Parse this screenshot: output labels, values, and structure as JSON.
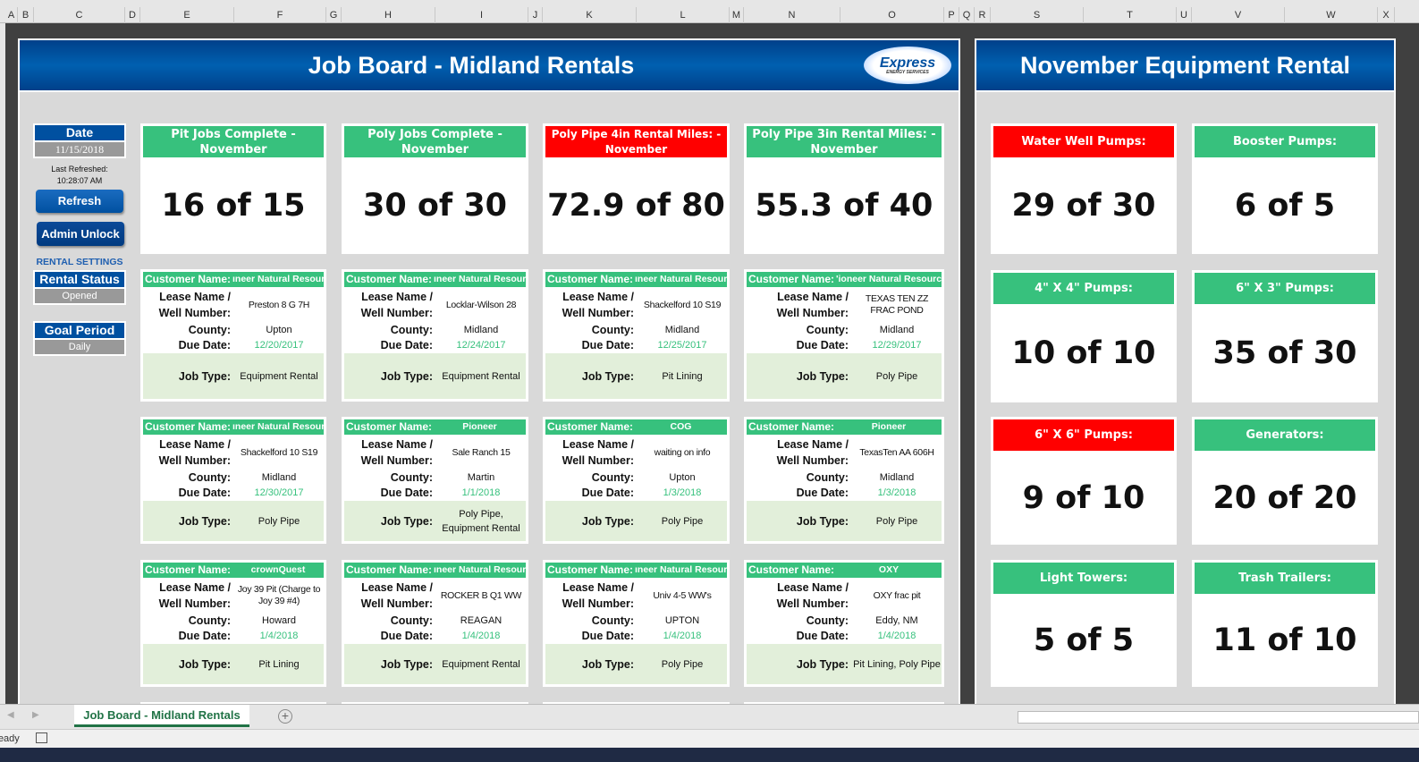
{
  "columns": [
    "A",
    "B",
    "C",
    "D",
    "E",
    "F",
    "G",
    "H",
    "I",
    "J",
    "K",
    "L",
    "M",
    "N",
    "O",
    "P",
    "Q",
    "R",
    "S",
    "T",
    "U",
    "V",
    "W",
    "X"
  ],
  "left_title": "Job Board - Midland Rentals",
  "logo": {
    "text": "Express",
    "sub": "ENERGY SERVICES"
  },
  "right_title": "November Equipment Rental",
  "colors": {
    "green": "#37c17d",
    "red": "#ff0000",
    "blue": "#0050a0",
    "light_green": "#e2efda"
  },
  "sidebar": {
    "date_label": "Date",
    "date_value": "11/15/2018",
    "last_refreshed": "Last Refreshed:",
    "refresh_time": "10:28:07 AM",
    "refresh_button": "Refresh",
    "admin_button": "Admin Unlock",
    "settings_label": "RENTAL SETTINGS",
    "rental_status_label": "Rental Status",
    "rental_status_value": "Opened",
    "goal_period_label": "Goal Period",
    "goal_period_value": "Daily"
  },
  "kpis": [
    {
      "title": "Pit Jobs Complete - November",
      "value": "16 of 15",
      "status": "green"
    },
    {
      "title": "Poly Jobs Complete - November",
      "value": "30 of 30",
      "status": "green"
    },
    {
      "title": "Poly Pipe 4in Rental Miles: - November",
      "value": "72.9 of 80",
      "status": "red"
    },
    {
      "title": "Poly Pipe 3in Rental Miles: - November",
      "value": "55.3 of 40",
      "status": "green"
    }
  ],
  "labels": {
    "customer": "Customer Name:",
    "lease": "Lease Name /",
    "well": "Well Number:",
    "county": "County:",
    "due": "Due Date:",
    "jobtype": "Job Type:"
  },
  "jobs": [
    {
      "customer": "ıneer Natural Resourc",
      "lease": "Preston 8 G 7H",
      "county": "Upton",
      "due": "12/20/2017",
      "type": "Equipment Rental"
    },
    {
      "customer": "ıneer Natural Resourc",
      "lease": "Locklar-Wilson 28",
      "county": "Midland",
      "due": "12/24/2017",
      "type": "Equipment Rental"
    },
    {
      "customer": "ıneer Natural Resourc",
      "lease": "Shackelford 10 S19",
      "county": "Midland",
      "due": "12/25/2017",
      "type": "Pit Lining"
    },
    {
      "customer": "'ioneer Natural Resource",
      "lease": "TEXAS TEN ZZ FRAC POND",
      "county": "Midland",
      "due": "12/29/2017",
      "type": "Poly Pipe"
    },
    {
      "customer": "ıneer Natural Resourc",
      "lease": "Shackelford 10 S19",
      "county": "Midland",
      "due": "12/30/2017",
      "type": "Poly Pipe"
    },
    {
      "customer": "Pioneer",
      "lease": "Sale Ranch 15",
      "county": "Martin",
      "due": "1/1/2018",
      "type": "Poly Pipe, Equipment Rental"
    },
    {
      "customer": "COG",
      "lease": "waiting on info",
      "county": "Upton",
      "due": "1/3/2018",
      "type": "Poly Pipe"
    },
    {
      "customer": "Pioneer",
      "lease": "TexasTen AA 606H",
      "county": "Midland",
      "due": "1/3/2018",
      "type": "Poly Pipe"
    },
    {
      "customer": "crownQuest",
      "lease": "Joy 39 Pit (Charge to Joy 39 #4)",
      "county": "Howard",
      "due": "1/4/2018",
      "type": "Pit Lining"
    },
    {
      "customer": "ıneer Natural Resourc",
      "lease": "ROCKER B Q1 WW",
      "county": "REAGAN",
      "due": "1/4/2018",
      "type": "Equipment Rental"
    },
    {
      "customer": "ıneer Natural Resourc",
      "lease": "Univ 4-5 WW's",
      "county": "UPTON",
      "due": "1/4/2018",
      "type": "Poly Pipe"
    },
    {
      "customer": "OXY",
      "lease": "OXY frac pit",
      "county": "Eddy, NM",
      "due": "1/4/2018",
      "type": "Pit Lining, Poly Pipe"
    }
  ],
  "equipment": [
    {
      "title": "Water Well Pumps:",
      "value": "29 of 30",
      "status": "red"
    },
    {
      "title": "Booster Pumps:",
      "value": "6 of 5",
      "status": "green"
    },
    {
      "title": "4\" X 4\" Pumps:",
      "value": "10 of 10",
      "status": "green"
    },
    {
      "title": "6\" X 3\" Pumps:",
      "value": "35 of 30",
      "status": "green"
    },
    {
      "title": "6\" X 6\" Pumps:",
      "value": "9 of 10",
      "status": "red"
    },
    {
      "title": "Generators:",
      "value": "20 of 20",
      "status": "green"
    },
    {
      "title": "Light Towers:",
      "value": "5 of 5",
      "status": "green"
    },
    {
      "title": "Trash Trailers:",
      "value": "11 of 10",
      "status": "green"
    }
  ],
  "sheet_tab": "Job Board - Midland Rentals",
  "status_text": "Ready"
}
